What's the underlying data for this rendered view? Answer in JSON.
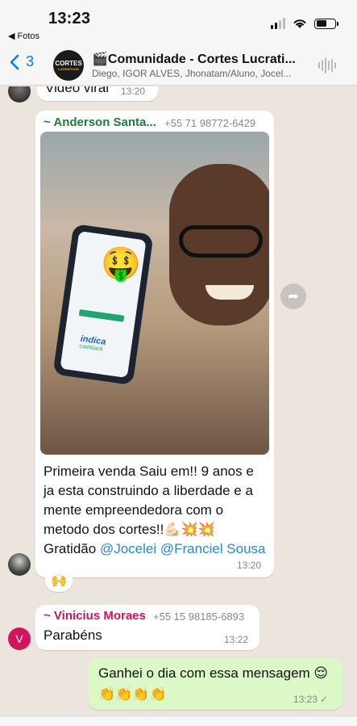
{
  "status_bar": {
    "time": "13:23",
    "back_app": "◀ Fotos"
  },
  "header": {
    "back_count": "3",
    "avatar_text": "CORTES",
    "avatar_sub": "LUCRATIVOS",
    "title": "🎬Comunidade - Cortes Lucrati...",
    "members": "Diego, IGOR ALVES, Jhonatam/Aluno, Jocel..."
  },
  "messages": [
    {
      "text": "Video viral",
      "time": "13:20"
    },
    {
      "sender": "~ Anderson Santa...",
      "phone": "+55 71 98772-6429",
      "text_parts": [
        "Primeira venda Saiu em!! 9 anos e ja esta construindo a liberdade e a mente empreendedora com o metodo dos cortes!!💪🏻💥💥 Gratidão ",
        "@Jocelei",
        " ",
        "@Franciel Sousa"
      ],
      "time": "13:20",
      "phone_screen_logo": "indica",
      "phone_screen_logo2": "cashback"
    },
    {
      "reaction": "🙌"
    },
    {
      "sender": "~ Vinicius Moraes",
      "phone": "+55 15 98185-6893",
      "text": "Parabéns",
      "time": "13:22",
      "avatar_initial": "V"
    },
    {
      "text": "Ganhei o dia com essa mensagem 😌 👏👏👏👏",
      "time": "13:23",
      "tick": "✓"
    }
  ],
  "colors": {
    "accent": "#007aff",
    "sender_anderson": "#1f7a3c",
    "sender_vinicius": "#d4145a",
    "mention": "#2a88d8",
    "outgoing_bubble": "#dcf8c6",
    "chat_background": "#ece5dd"
  },
  "icons": {
    "back": "chevron-left-icon",
    "audio": "waveform-icon",
    "forward": "forward-arrow-icon",
    "wifi": "wifi-icon",
    "battery": "battery-icon",
    "signal": "signal-icon"
  }
}
